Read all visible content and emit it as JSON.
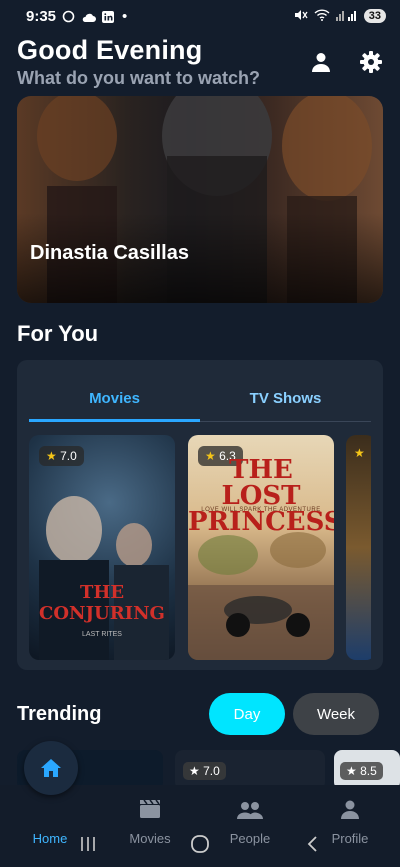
{
  "status": {
    "time": "9:35",
    "battery": "33"
  },
  "header": {
    "greeting": "Good Evening",
    "subtitle": "What do you want to watch?"
  },
  "hero": {
    "title": "Dinastia Casillas"
  },
  "for_you": {
    "title": "For You",
    "tabs": [
      "Movies",
      "TV Shows"
    ],
    "posters": [
      {
        "rating": "7.0",
        "title_main": "THE CONJURING",
        "title_sub": "LAST RITES"
      },
      {
        "rating": "6.3",
        "title_main": "THE LOST PRINCESS",
        "tagline": "LOVE WILL SPARK THE ADVENTURE"
      },
      {
        "rating": ""
      }
    ]
  },
  "trending": {
    "title": "Trending",
    "day_label": "Day",
    "week_label": "Week",
    "cards": [
      {
        "rating": "7.0"
      },
      {
        "rating": "8.5"
      }
    ]
  },
  "nav": {
    "items": [
      {
        "label": "Home",
        "icon": "home-icon"
      },
      {
        "label": "Movies",
        "icon": "clapperboard-icon"
      },
      {
        "label": "People",
        "icon": "people-icon"
      },
      {
        "label": "Profile",
        "icon": "person-icon"
      }
    ]
  },
  "colors": {
    "accent": "#00e5ff",
    "tab_active": "#3fb6ff",
    "background": "#131d2c",
    "star": "#f5c518"
  }
}
